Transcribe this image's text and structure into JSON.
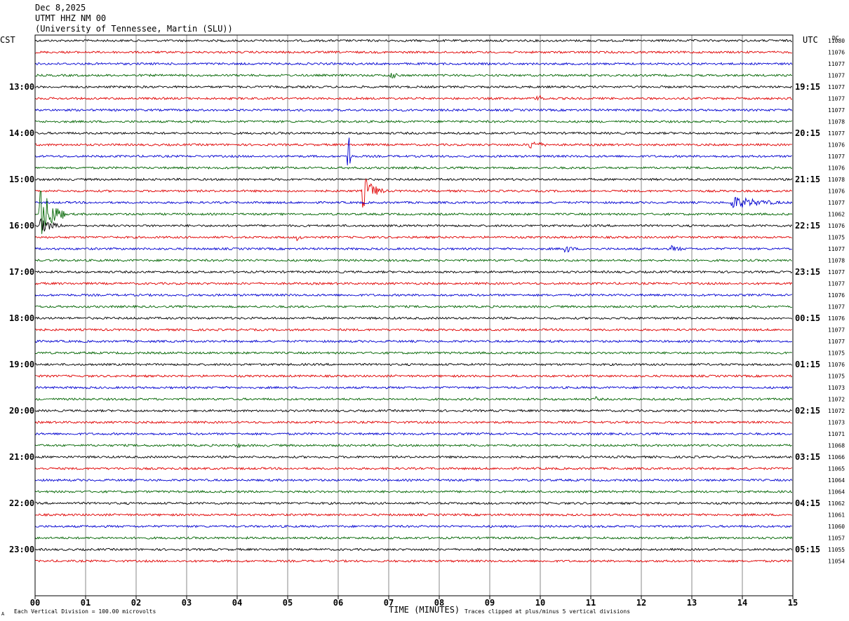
{
  "header": {
    "date": "Dec 8,2025",
    "station": "UTMT HHZ NM 00",
    "network": "(University of Tennessee, Martin (SLU))"
  },
  "left_tz": "CST",
  "right_tz": "UTC",
  "dc_label": "DC",
  "footer": {
    "scale": "Each Vertical Division =  100.00 microvolts",
    "clip": "Traces clipped at plus/minus 5 vertical divisions",
    "mark": "A"
  },
  "chart_data": {
    "type": "line",
    "xlabel": "TIME (MINUTES)",
    "x_ticks": [
      "00",
      "01",
      "02",
      "03",
      "04",
      "05",
      "06",
      "07",
      "08",
      "09",
      "10",
      "11",
      "12",
      "13",
      "14",
      "15"
    ],
    "xlim": [
      0,
      15
    ],
    "trace_colors": [
      "#000000",
      "#e00000",
      "#0000d0",
      "#006400"
    ],
    "left_hour_labels": [
      "13:00",
      "14:00",
      "15:00",
      "16:00",
      "17:00",
      "18:00",
      "19:00",
      "20:00",
      "21:00",
      "22:00",
      "23:00"
    ],
    "right_hour_labels": [
      "19:15",
      "20:15",
      "21:15",
      "22:15",
      "23:15",
      "00:15",
      "01:15",
      "02:15",
      "03:15",
      "04:15",
      "05:15"
    ],
    "dc_values": [
      "11080",
      "11076",
      "11077",
      "11077",
      "11077",
      "11077",
      "11077",
      "11078",
      "11077",
      "11076",
      "11077",
      "11076",
      "11078",
      "11076",
      "11077",
      "11062",
      "11076",
      "11075",
      "11077",
      "11078",
      "11077",
      "11077",
      "11076",
      "11077",
      "11076",
      "11077",
      "11077",
      "11075",
      "11076",
      "11075",
      "11073",
      "11072",
      "11072",
      "11073",
      "11071",
      "11068",
      "11066",
      "11065",
      "11064",
      "11064",
      "11062",
      "11061",
      "11060",
      "11057",
      "11055",
      "11054"
    ],
    "events": [
      {
        "trace": 3,
        "minute": 7.05,
        "amp": 6,
        "dur": 0.25
      },
      {
        "trace": 5,
        "minute": 9.95,
        "amp": 6,
        "dur": 0.3
      },
      {
        "trace": 9,
        "minute": 9.8,
        "amp": 7,
        "dur": 0.5
      },
      {
        "trace": 10,
        "minute": 6.2,
        "amp": 60,
        "dur": 0.05
      },
      {
        "trace": 13,
        "minute": 6.5,
        "amp": 24,
        "dur": 0.4
      },
      {
        "trace": 14,
        "minute": 13.8,
        "amp": 10,
        "dur": 1.2
      },
      {
        "trace": 15,
        "minute": 0.1,
        "amp": 40,
        "dur": 0.5
      },
      {
        "trace": 16,
        "minute": 0.1,
        "amp": 12,
        "dur": 0.5
      },
      {
        "trace": 17,
        "minute": 5.2,
        "amp": 5,
        "dur": 0.2
      },
      {
        "trace": 18,
        "minute": 10.5,
        "amp": 7,
        "dur": 0.3
      },
      {
        "trace": 18,
        "minute": 12.6,
        "amp": 5,
        "dur": 0.5
      },
      {
        "trace": 31,
        "minute": 11.1,
        "amp": 4,
        "dur": 0.2
      },
      {
        "trace": 35,
        "minute": 4.0,
        "amp": 4,
        "dur": 0.2
      }
    ]
  }
}
